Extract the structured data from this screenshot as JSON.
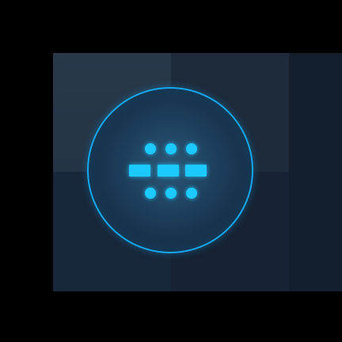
{
  "icon": {
    "name": "app-grid-launcher-icon",
    "accent_color": "#14a8f2",
    "glyph_color": "#1dcaff",
    "background_color": "#172231",
    "dot_rows": [
      3,
      3
    ],
    "bar_count": 3
  }
}
